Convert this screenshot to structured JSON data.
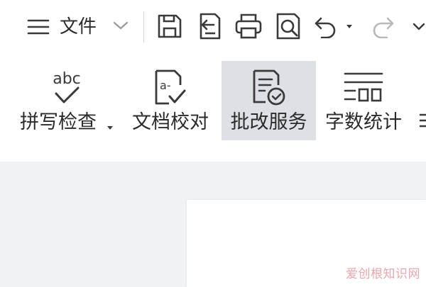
{
  "toolbar": {
    "menu_icon": "hamburger-icon",
    "file_label": "文件",
    "icons": [
      "save-icon",
      "export-icon",
      "print-icon",
      "print-preview-icon",
      "undo-icon",
      "redo-icon",
      "more-dropdown-icon"
    ]
  },
  "ribbon": {
    "items": [
      {
        "label": "拼写检查",
        "icon": "spellcheck-icon",
        "has_dropdown": true
      },
      {
        "label": "文档校对",
        "icon": "document-proofread-icon"
      },
      {
        "label": "批改服务",
        "icon": "correction-service-icon",
        "active": true
      },
      {
        "label": "字数统计",
        "icon": "word-count-icon"
      }
    ]
  },
  "watermark": "爱创根知识网",
  "colors": {
    "icon": "#3a3a3a",
    "active_bg": "#dde1e6",
    "workspace_bg": "#f1f2f4",
    "watermark": "#e7a7ad"
  }
}
